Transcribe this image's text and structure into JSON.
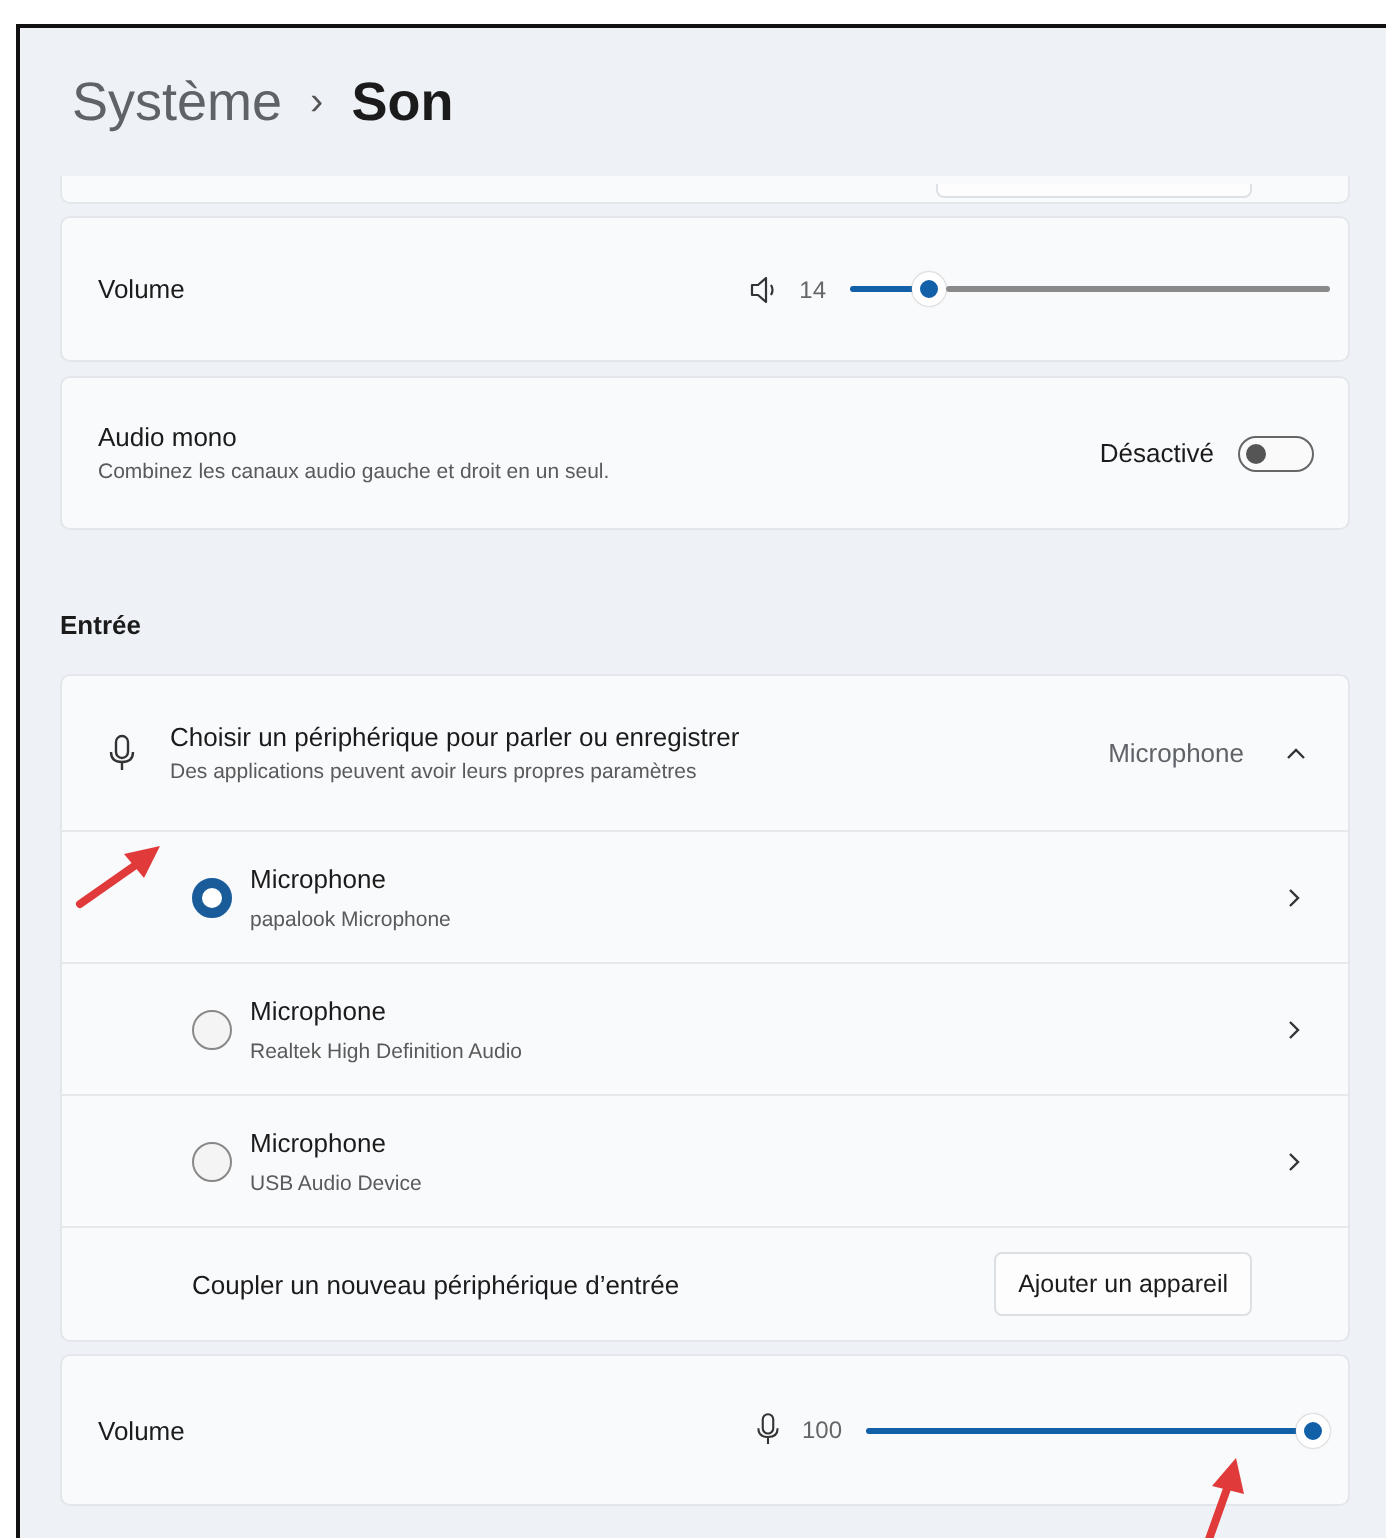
{
  "header": {
    "parent": "Système",
    "separator": "›",
    "title": "Son"
  },
  "output_volume": {
    "label": "Volume",
    "reading": "14",
    "level": 0.14
  },
  "mono": {
    "title": "Audio mono",
    "description": "Combinez les canaux audio gauche et droit en un seul.",
    "state_label": "Désactivé",
    "on": false
  },
  "input": {
    "heading": "Entrée",
    "chooser": {
      "title": "Choisir un périphérique pour parler ou enregistrer",
      "description": "Des applications peuvent avoir leurs propres paramètres",
      "value": "Microphone",
      "expanded": true
    },
    "devices": [
      {
        "name": "Microphone",
        "detail": "papalook Microphone",
        "selected": true
      },
      {
        "name": "Microphone",
        "detail": "Realtek High Definition Audio",
        "selected": false
      },
      {
        "name": "Microphone",
        "detail": "USB Audio Device",
        "selected": false
      }
    ],
    "pair": {
      "label": "Coupler un nouveau périphérique d’entrée",
      "button": "Ajouter un appareil"
    }
  },
  "input_volume": {
    "label": "Volume",
    "reading": "100",
    "level": 1.0
  }
}
